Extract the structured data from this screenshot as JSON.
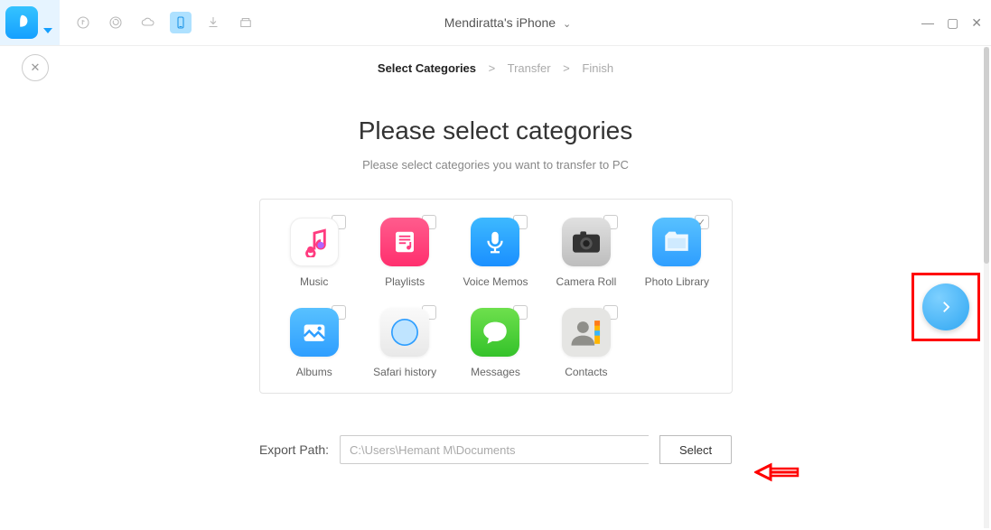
{
  "device_title": "Mendiratta's iPhone",
  "breadcrumb": {
    "step1": "Select Categories",
    "step2": "Transfer",
    "step3": "Finish"
  },
  "heading": "Please select categories",
  "subheading": "Please select categories you want to transfer to PC",
  "categories": {
    "music": "Music",
    "playlists": "Playlists",
    "voice": "Voice Memos",
    "camera": "Camera Roll",
    "photo": "Photo Library",
    "albums": "Albums",
    "safari": "Safari history",
    "messages": "Messages",
    "contacts": "Contacts"
  },
  "photo_checked": "✓",
  "export": {
    "label": "Export Path:",
    "path": "C:\\Users\\Hemant M\\Documents",
    "select_btn": "Select"
  }
}
